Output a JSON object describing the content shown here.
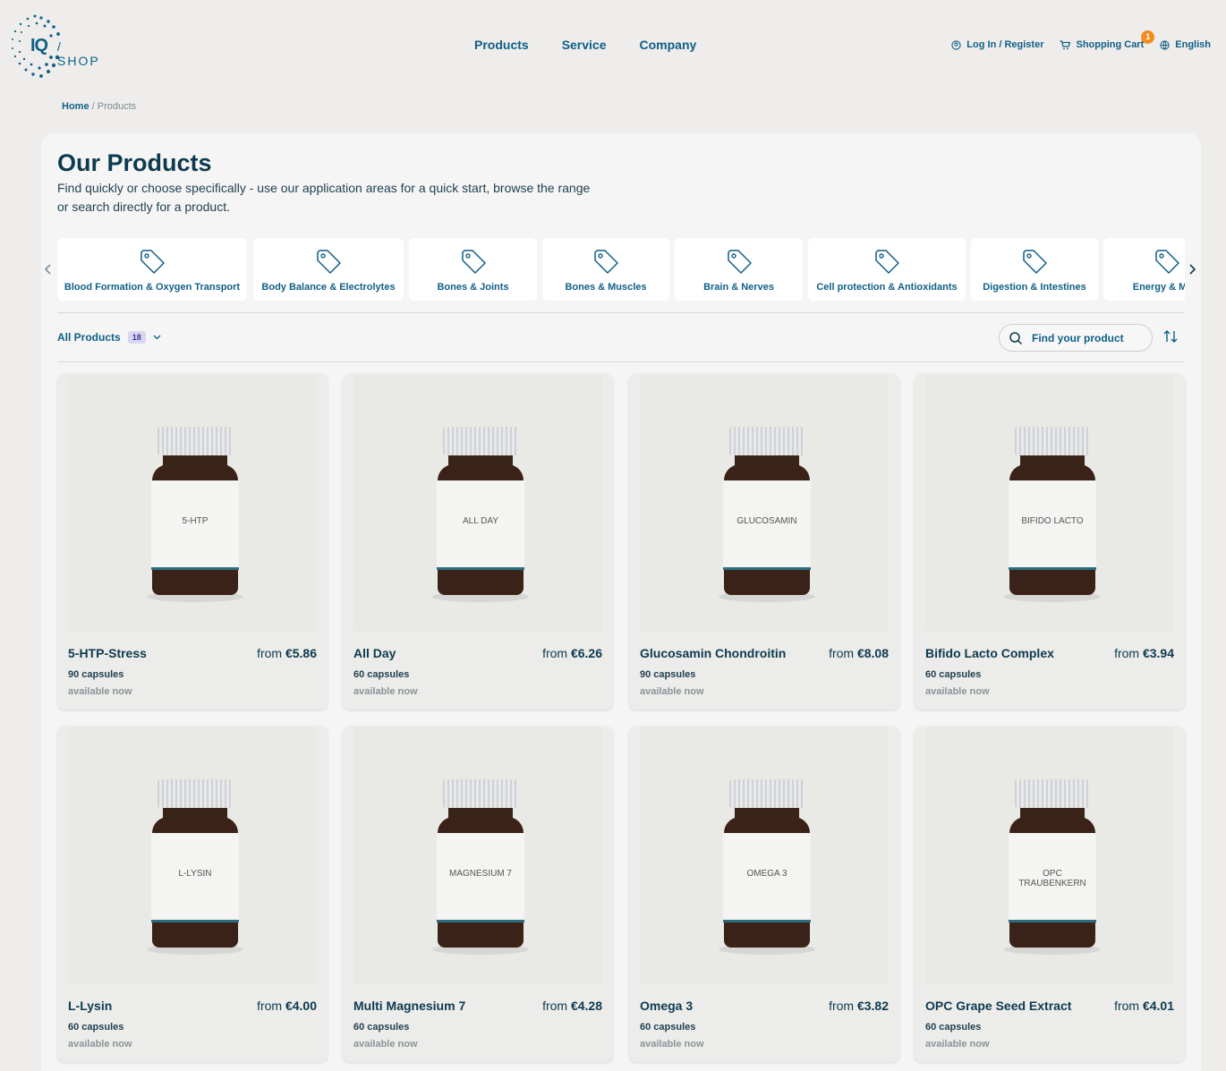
{
  "brand": {
    "logo_mark": "IQ",
    "logo_text": "/ SHOP"
  },
  "nav": {
    "products": "Products",
    "service": "Service",
    "company": "Company"
  },
  "user_nav": {
    "login": "Log In / Register",
    "cart": "Shopping Cart",
    "cart_count": "1",
    "language": "English"
  },
  "breadcrumb": {
    "home": "Home",
    "current": "/ Products"
  },
  "page": {
    "title": "Our Products",
    "intro": "Find quickly or choose specifically - use our application areas for a quick start, browse the range or search directly for a product."
  },
  "categories": [
    "Blood Formation & Oxygen Transport",
    "Body Balance & Electrolytes",
    "Bones & Joints",
    "Bones & Muscles",
    "Brain & Nerves",
    "Cell protection & Antioxidants",
    "Digestion & Intestines",
    "Energy & Meta"
  ],
  "filter": {
    "label": "All Products",
    "count": "18",
    "search_placeholder": "Find your product"
  },
  "products": [
    {
      "name": "5-HTP-Stress",
      "price_prefix": "from",
      "price": "€5.86",
      "capsules": "90 capsules",
      "availability": "available now",
      "label_text": "5-HTP"
    },
    {
      "name": "All Day",
      "price_prefix": "from",
      "price": "€6.26",
      "capsules": "60 capsules",
      "availability": "available now",
      "label_text": "ALL DAY"
    },
    {
      "name": "Glucosamin Chondroitin",
      "price_prefix": "from",
      "price": "€8.08",
      "capsules": "90 capsules",
      "availability": "available now",
      "label_text": "GLUCOSAMIN"
    },
    {
      "name": "Bifido Lacto Complex",
      "price_prefix": "from",
      "price": "€3.94",
      "capsules": "60 capsules",
      "availability": "available now",
      "label_text": "BIFIDO LACTO"
    },
    {
      "name": "L-Lysin",
      "price_prefix": "from",
      "price": "€4.00",
      "capsules": "60 capsules",
      "availability": "available now",
      "label_text": "L-LYSIN"
    },
    {
      "name": "Multi Magnesium 7",
      "price_prefix": "from",
      "price": "€4.28",
      "capsules": "60 capsules",
      "availability": "available now",
      "label_text": "MAGNESIUM 7"
    },
    {
      "name": "Omega 3",
      "price_prefix": "from",
      "price": "€3.82",
      "capsules": "60 capsules",
      "availability": "available now",
      "label_text": "OMEGA 3"
    },
    {
      "name": "OPC Grape Seed Extract",
      "price_prefix": "from",
      "price": "€4.01",
      "capsules": "60 capsules",
      "availability": "available now",
      "label_text": "OPC TRAUBENKERN"
    }
  ]
}
